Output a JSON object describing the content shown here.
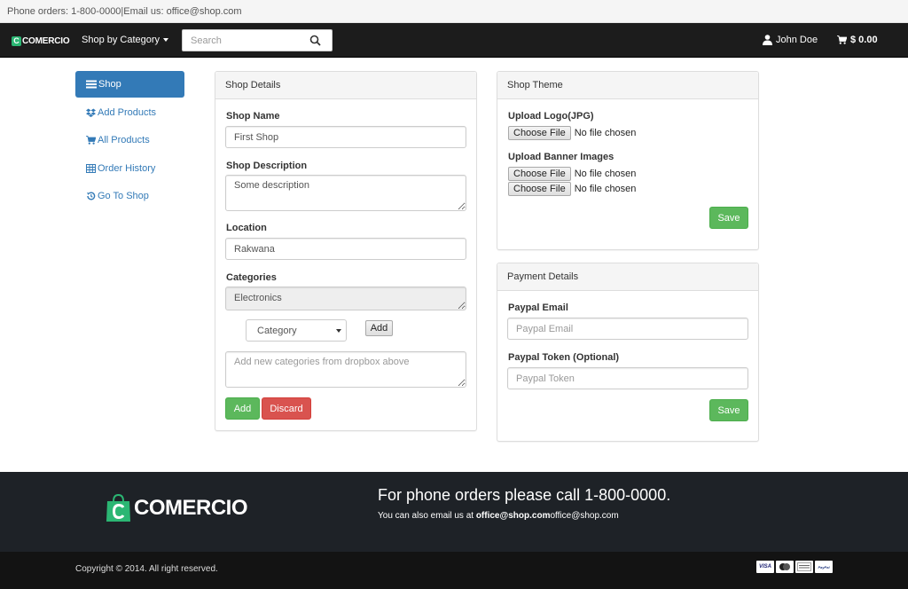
{
  "topbar": {
    "text": "Phone orders: 1-800-0000|Email us: office@shop.com"
  },
  "navbar": {
    "brand": "COMERCIO",
    "brand_letter": "C",
    "category_menu": "Shop by Category",
    "search_placeholder": "Search",
    "user": "John Doe",
    "cart": "$ 0.00"
  },
  "sidebar": {
    "items": [
      {
        "label": "Shop",
        "icon": "list-icon",
        "active": true
      },
      {
        "label": "Add Products",
        "icon": "dropbox-icon"
      },
      {
        "label": "All Products",
        "icon": "cart-icon"
      },
      {
        "label": "Order History",
        "icon": "table-icon"
      },
      {
        "label": "Go To Shop",
        "icon": "history-icon"
      }
    ]
  },
  "shop_details": {
    "heading": "Shop Details",
    "name_label": "Shop Name",
    "name_value": "First Shop",
    "description_label": "Shop Description",
    "description_value": "Some description",
    "location_label": "Location",
    "location_value": "Rakwana",
    "categories_label": "Categories",
    "categories_value": "Electronics",
    "category_select": "Category",
    "add_small": "Add",
    "new_categories_placeholder": "Add new categories from dropbox above",
    "add_button": "Add",
    "discard_button": "Discard"
  },
  "shop_theme": {
    "heading": "Shop Theme",
    "logo_label": "Upload Logo(JPG)",
    "banner_label": "Upload Banner Images",
    "choose_file": "Choose File",
    "no_file": "No file chosen",
    "save": "Save"
  },
  "payment": {
    "heading": "Payment Details",
    "paypal_email_label": "Paypal Email",
    "paypal_email_placeholder": "Paypal Email",
    "paypal_token_label": "Paypal Token (Optional)",
    "paypal_token_placeholder": "Paypal Token",
    "save": "Save"
  },
  "footer": {
    "logo_text": "COMERCIO",
    "phone_text": "For phone orders please call 1-800-0000.",
    "email_prefix": "You can also email us at ",
    "email_bold": "office@shop.com",
    "email_plain": "office@shop.com",
    "copyright": "Copyright © 2014. All right reserved.",
    "cards": [
      "VISA",
      "MC",
      "AMEX",
      "PayPal"
    ]
  },
  "colors": {
    "primary": "#337ab7",
    "success": "#5cb85c",
    "danger": "#d9534f",
    "navbar": "#1c1c1c",
    "brand_green": "#2bb673"
  }
}
